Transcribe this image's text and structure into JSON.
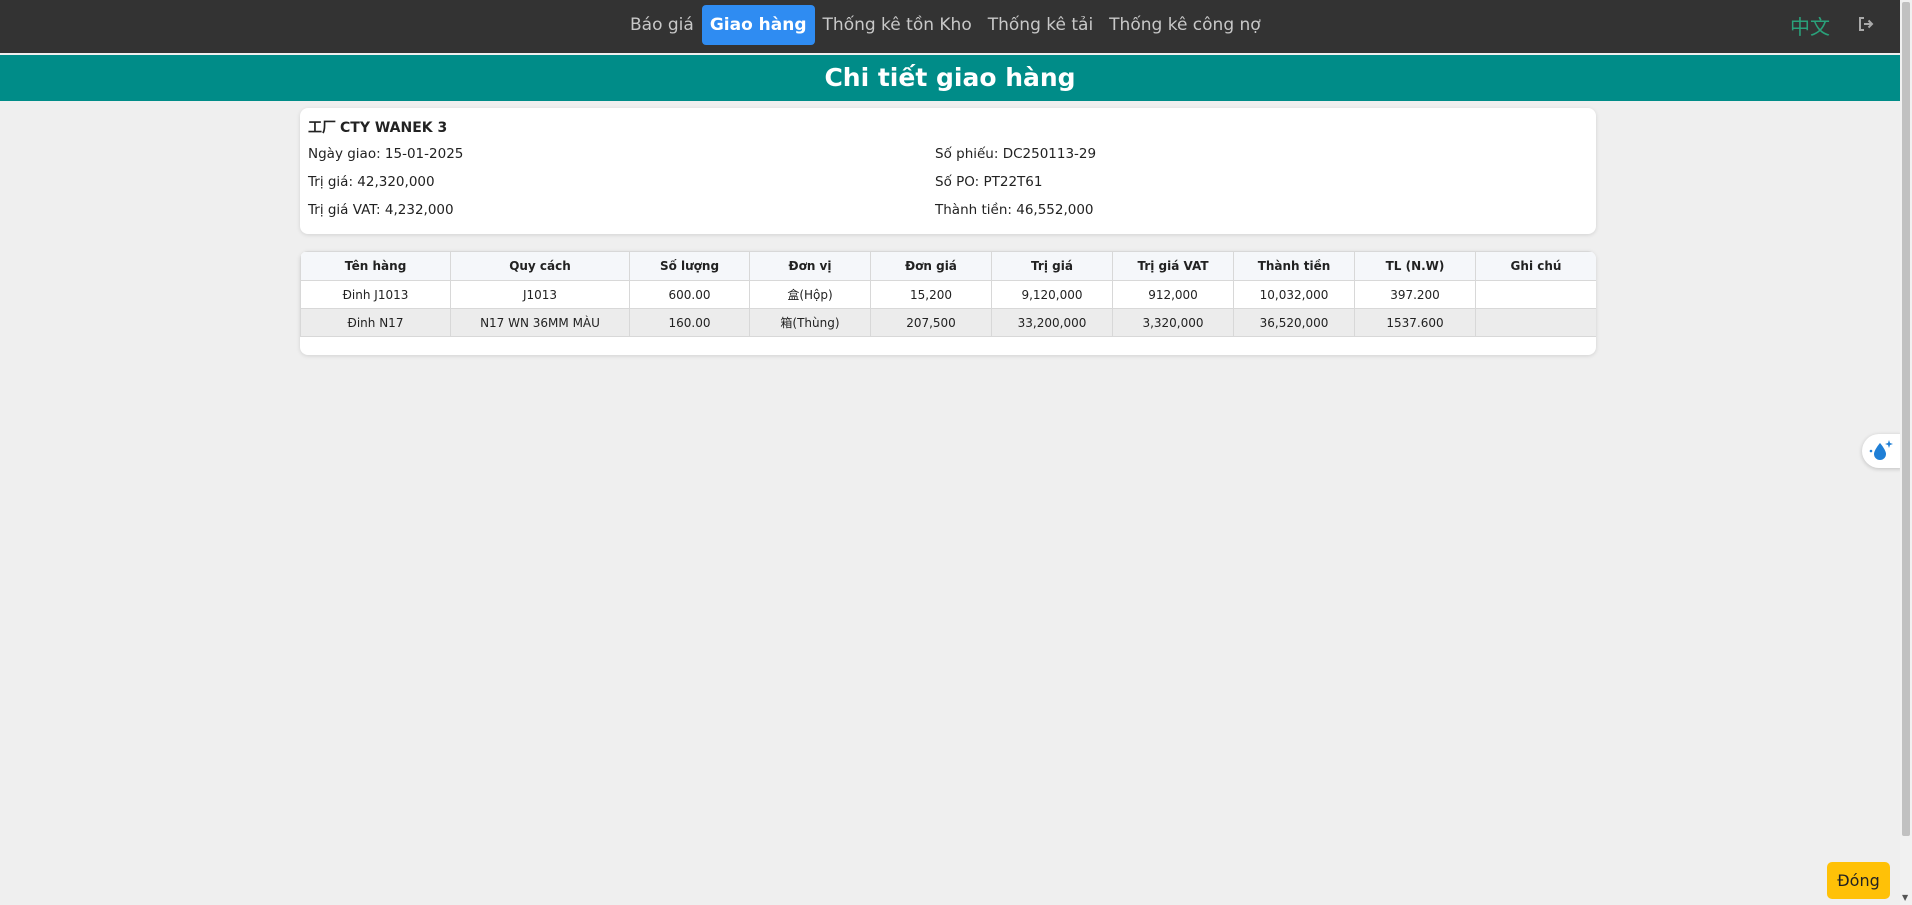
{
  "nav": {
    "items": [
      {
        "label": "Báo giá",
        "active": false
      },
      {
        "label": "Giao hàng",
        "active": true
      },
      {
        "label": "Thống kê tồn Kho",
        "active": false
      },
      {
        "label": "Thống kê tải",
        "active": false
      },
      {
        "label": "Thống kê công nợ",
        "active": false
      }
    ],
    "language": "中文",
    "logout_icon": "logout-icon"
  },
  "page_title": "Chi tiết giao hàng",
  "info": {
    "company_icon": "工厂",
    "company": "CTY WANEK 3",
    "delivery_date": "Ngày giao: 15-01-2025",
    "value": "Trị giá: 42,320,000",
    "vat_value": "Trị giá VAT: 4,232,000",
    "slip_no": "Số phiếu: DC250113-29",
    "po_no": "Số PO: PT22T61",
    "total": "Thành tiền: 46,552,000"
  },
  "table": {
    "headers": [
      "Tên hàng",
      "Quy cách",
      "Số lượng",
      "Đơn vị",
      "Đơn giá",
      "Trị giá",
      "Trị giá VAT",
      "Thành tiền",
      "TL (N.W)",
      "Ghi chú"
    ],
    "rows": [
      [
        "Đinh J1013",
        "J1013",
        "600.00",
        "盒(Hộp)",
        "15,200",
        "9,120,000",
        "912,000",
        "10,032,000",
        "397.200",
        ""
      ],
      [
        "Đinh N17",
        "N17 WN 36MM MÀU",
        "160.00",
        "箱(Thùng)",
        "207,500",
        "33,200,000",
        "3,320,000",
        "36,520,000",
        "1537.600",
        ""
      ]
    ]
  },
  "close_label": "Đóng",
  "colors": {
    "nav_bg": "#333333",
    "active_tab": "#2f8cf2",
    "title_bar": "#008c88",
    "close_button": "#ffc107",
    "language_link": "#2aa17a"
  }
}
